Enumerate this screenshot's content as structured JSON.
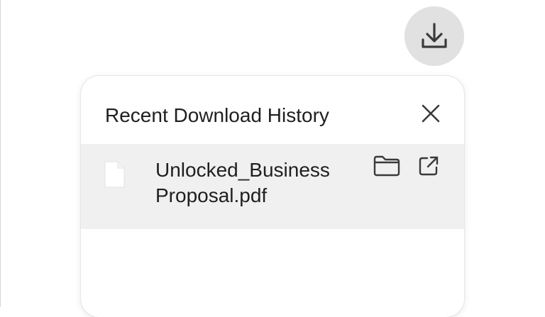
{
  "panel": {
    "title": "Recent Download History",
    "close_icon": "close-icon"
  },
  "toolbar": {
    "download_icon": "download-icon"
  },
  "downloads": [
    {
      "file_name": "Unlocked_Business Proposal.pdf",
      "file_icon": "file-icon",
      "actions": [
        "folder-icon",
        "open-external-icon"
      ]
    }
  ],
  "colors": {
    "download_button_bg": "#e1e1e1",
    "item_bg": "#f0f0f0",
    "text": "#1f1f1f",
    "icon": "#3a3a3a"
  }
}
